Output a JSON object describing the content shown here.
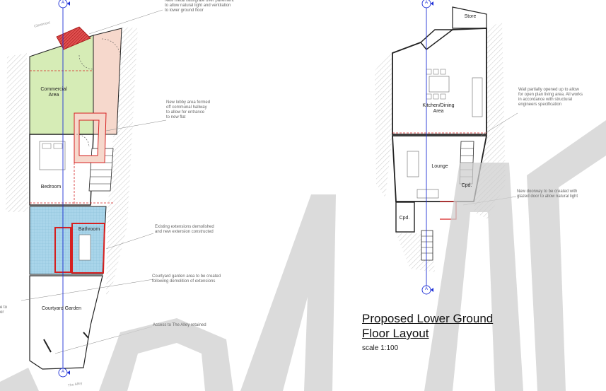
{
  "drawing": {
    "title_line1": "Proposed Lower Ground",
    "title_line2": "Floor Layout",
    "scale": "scale 1:100",
    "section_marker": "A",
    "watermark": "DRAFT"
  },
  "left_plan": {
    "street_label": "Claremont",
    "alley_label": "The Alley",
    "rooms": {
      "commercial": "Commercial\nArea",
      "bedroom": "Bedroom",
      "bathroom": "Bathroom",
      "courtyard": "Courtyard Garden"
    },
    "annotations": {
      "railings": "New metal rails/grate over pavement\nto allow natural light and ventilation\nto lower ground floor",
      "lobby": "New lobby area formed\noff communal hallway\nto allow for entrance\nto new flat",
      "extensions": "Existing extensions demolished\nand new extension constructed",
      "courtyard_note": "Courtyard garden area to be created\nfollowing demolition of extensions",
      "alley_access": "Access to The Alley retained",
      "cut_left": "e to\nor"
    }
  },
  "right_plan": {
    "rooms": {
      "store": "Store",
      "kitchen": "Kitchen/Dining\nArea",
      "lounge": "Lounge",
      "cupboard_right": "Cpd.",
      "cupboard_left": "Cpd."
    },
    "annotations": {
      "wall": "Wall partially opened up to allow\nfor open plan living area. All works\nin accordance with structural\nengineers specification",
      "doorway": "New doorway to be created with\nglazed door to allow natural light"
    }
  },
  "colors": {
    "line": "#222222",
    "section_line": "#1d2fd6",
    "new_wall": "#d62020",
    "commercial_fill": "#d6ecb6",
    "lobby_fill": "#f6d8cc",
    "bathroom_fill": "#a9d5ea",
    "hatch": "#bbbbbb"
  }
}
